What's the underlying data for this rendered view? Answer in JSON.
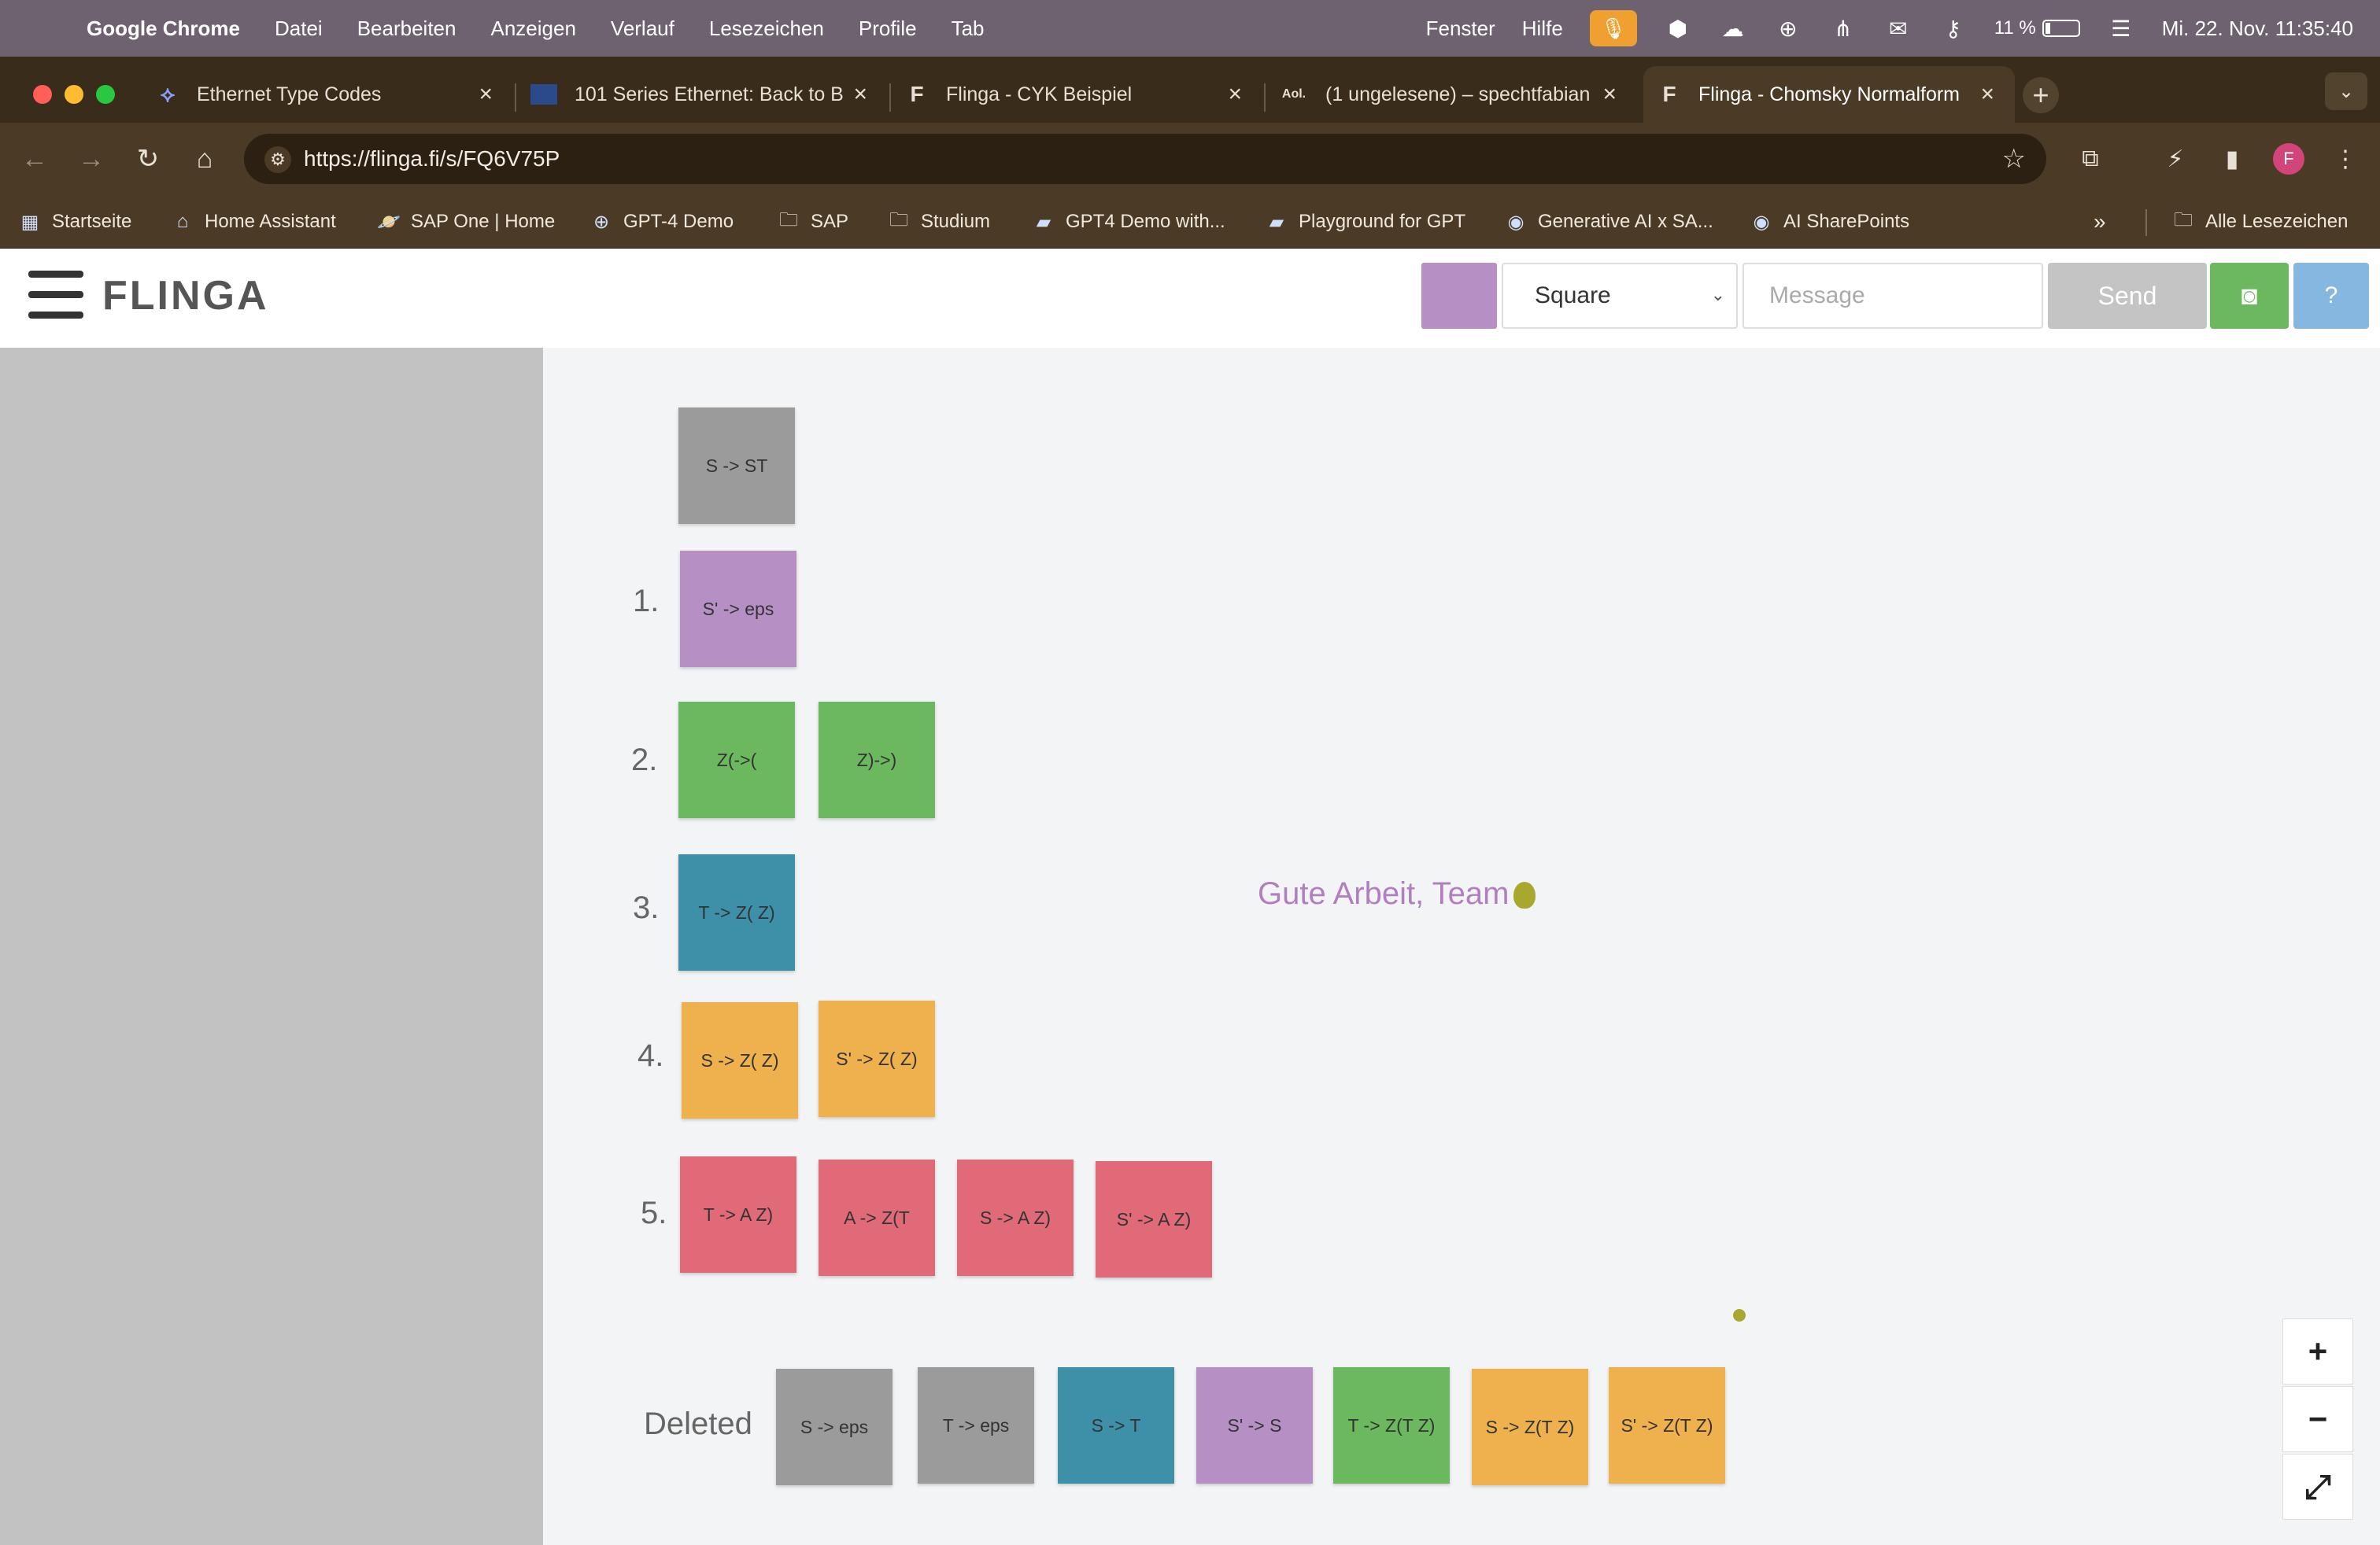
{
  "menubar": {
    "app": "Google Chrome",
    "items": [
      "Datei",
      "Bearbeiten",
      "Anzeigen",
      "Verlauf",
      "Lesezeichen",
      "Profile",
      "Tab"
    ],
    "right_items": [
      "Fenster",
      "Hilfe"
    ],
    "battery": "11 %",
    "clock": "Mi. 22. Nov.  11:35:40"
  },
  "tabs": [
    {
      "title": "Ethernet Type Codes",
      "favicon": "rocket-icon"
    },
    {
      "title": "101 Series Ethernet: Back to B",
      "favicon": "image-icon"
    },
    {
      "title": "Flinga - CYK Beispiel",
      "favicon": "F"
    },
    {
      "title": "(1 ungelesene) – spechtfabian",
      "favicon": "Aol."
    },
    {
      "title": "Flinga - Chomsky Normalform",
      "favicon": "F"
    }
  ],
  "omnibox": {
    "url": "https://flinga.fi/s/FQ6V75P"
  },
  "bookmarks": [
    "Startseite",
    "Home Assistant",
    "SAP One | Home",
    "GPT-4 Demo",
    "SAP",
    "Studium",
    "GPT4 Demo with...",
    "Playground for GPT",
    "Generative AI x SA...",
    "AI SharePoints"
  ],
  "bookmarks_all": "Alle Lesezeichen",
  "app": {
    "logo": "FLINGA",
    "swatch_color": "#b68fc4",
    "shape_value": "Square",
    "message_placeholder": "Message",
    "send_label": "Send"
  },
  "colors": {
    "gray": "#9b9b9b",
    "purple": "#b68fc4",
    "green": "#6cb85e",
    "teal": "#3e8fa8",
    "orange": "#efb04e",
    "red": "#e06a78"
  },
  "canvas": {
    "numbers": [
      "1.",
      "2.",
      "3.",
      "4.",
      "5."
    ],
    "top_card": "S -> ST",
    "row1": [
      "S' -> eps"
    ],
    "row2": [
      "Z(->(",
      "Z)->)"
    ],
    "row3": [
      "T -> Z( Z)"
    ],
    "row4": [
      "S -> Z( Z)",
      "S' -> Z( Z)"
    ],
    "row5": [
      "T -> A Z)",
      "A -> Z(T",
      "S -> A Z)",
      "S' -> A Z)"
    ],
    "note": "Gute Arbeit, Team",
    "deleted_label": "Deleted",
    "deleted": [
      "S -> eps",
      "T -> eps",
      "S -> T",
      "S' -> S",
      "T -> Z(T Z)",
      "S -> Z(T Z)",
      "S' -> Z(T Z)"
    ]
  },
  "zoom": {
    "plus": "+",
    "minus": "−",
    "fit": "⤢"
  }
}
